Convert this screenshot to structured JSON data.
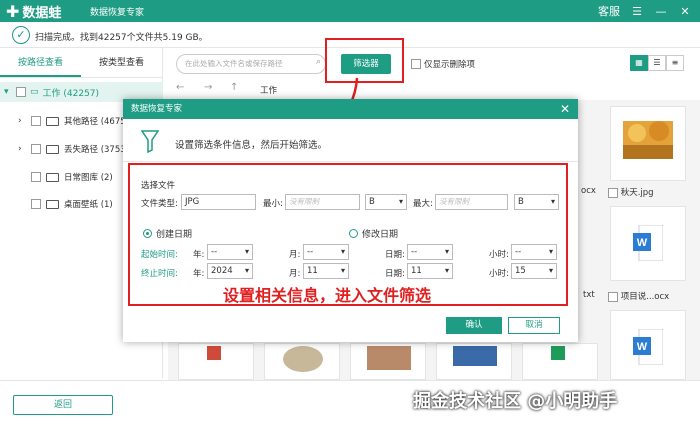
{
  "app": {
    "logo_text": "数据蛙",
    "subtitle": "数据恢复专家",
    "controls": {
      "account": "客服",
      "menu": "☰",
      "minimize": "—",
      "close": "✕"
    }
  },
  "status": {
    "text": "扫描完成。找到42257个文件共5.19 GB。"
  },
  "sidebar": {
    "tabs": [
      {
        "label": "按路径查看",
        "active": true
      },
      {
        "label": "按类型查看",
        "active": false
      }
    ],
    "root": "工作 (42257)",
    "items": [
      {
        "label": "其他路径 (4675",
        "expandable": true
      },
      {
        "label": "丢失路径 (37537",
        "expandable": true
      },
      {
        "label": "日常图库 (2)",
        "expandable": false
      },
      {
        "label": "桌面壁纸 (1)",
        "expandable": false
      }
    ]
  },
  "toolbar": {
    "search_placeholder": "在此处输入文件名或保存路径",
    "filter_label": "筛选器",
    "only_deleted_label": "仅显示删除项",
    "view_modes": [
      "grid-view-icon",
      "list-view-icon",
      "detail-view-icon"
    ]
  },
  "nav": {
    "breadcrumb": "工作"
  },
  "files": {
    "labels": [
      "ocx",
      "秋天.jpg",
      "txt",
      "项目说...ocx"
    ],
    "colors": {
      "word_blue": "#2b7cd3",
      "excel_green": "#1f9c5a",
      "ppt_red": "#d04a3a"
    }
  },
  "dialog": {
    "title": "数据恢复专家",
    "hint": "设置筛选条件信息，然后开始筛选。",
    "section_label": "选择文件",
    "file_type_label": "文件类型:",
    "file_type_value": "JPG",
    "min_label": "最小:",
    "min_placeholder": "没有限制",
    "min_unit": "B",
    "max_label": "最大:",
    "max_placeholder": "没有限制",
    "max_unit": "B",
    "radio_create": "创建日期",
    "radio_modify": "修改日期",
    "start_label": "起始时间:",
    "end_label": "终止时间:",
    "year_label": "年:",
    "month_label": "月:",
    "day_label": "日期:",
    "hour_label": "小时:",
    "start": {
      "year": "--",
      "month": "--",
      "day": "--",
      "hour": "--"
    },
    "end": {
      "year": "2024",
      "month": "11",
      "day": "11",
      "hour": "15"
    },
    "annotation": "设置相关信息，进入文件筛选",
    "ok_label": "确认",
    "cancel_label": "取消"
  },
  "bottom": {
    "back_label": "返回",
    "watermark": "掘金技术社区 @小明助手"
  },
  "colors": {
    "accent": "#1f9c84",
    "highlight": "#e02020"
  }
}
